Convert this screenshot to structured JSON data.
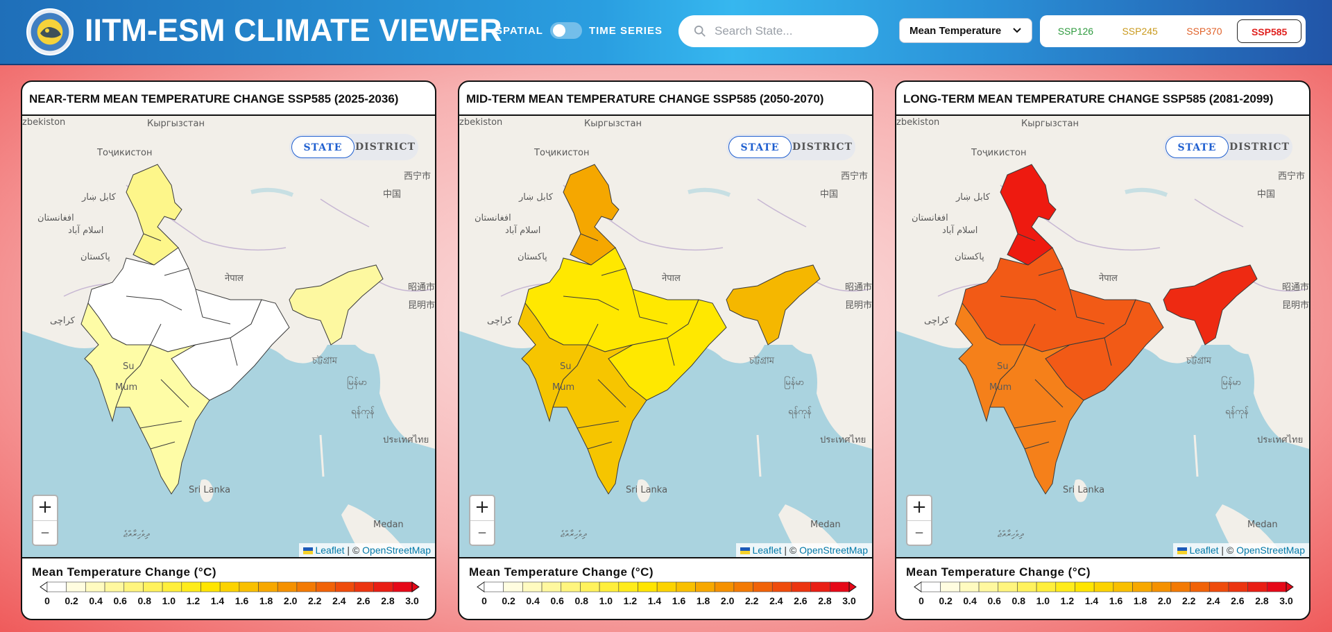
{
  "header": {
    "title": "IITM-ESM CLIMATE VIEWER",
    "toggle_left": "SPATIAL",
    "toggle_right": "TIME SERIES",
    "search_placeholder": "Search State...",
    "variable": "Mean Temperature",
    "scenarios": [
      {
        "label": "SSP126",
        "color": "#2e9a3e",
        "active": false
      },
      {
        "label": "SSP245",
        "color": "#c9991c",
        "active": false
      },
      {
        "label": "SSP370",
        "color": "#e0622a",
        "active": false
      },
      {
        "label": "SSP585",
        "color": "#e0201e",
        "active": true
      }
    ]
  },
  "panels": [
    {
      "title": "NEAR-TERM MEAN TEMPERATURE CHANGE SSP585 (2025-2036)",
      "fill_north": "#fdf68a",
      "fill_central": "#ffffff",
      "fill_south": "#fefca6",
      "fill_ne": "#fdf8a0"
    },
    {
      "title": "MID-TERM MEAN TEMPERATURE CHANGE SSP585 (2050-2070)",
      "fill_north": "#f5a700",
      "fill_central": "#ffe800",
      "fill_south": "#f6c500",
      "fill_ne": "#f5b700"
    },
    {
      "title": "LONG-TERM MEAN TEMPERATURE CHANGE SSP585 (2081-2099)",
      "fill_north": "#ee1a10",
      "fill_central": "#f25a16",
      "fill_south": "#f5801a",
      "fill_ne": "#ee2a12"
    }
  ],
  "map": {
    "mode_state": "STATE",
    "mode_district": "DISTRICT",
    "zoom_in": "+",
    "zoom_out": "–",
    "attribution_leaflet": "Leaflet",
    "attribution_sep": " | © ",
    "attribution_osm": "OpenStreetMap",
    "labels": [
      "zbekiston",
      "Кыргызстан",
      "Тоҷикистон",
      "西宁市",
      "中国",
      "کابل ښار",
      "افغانستان",
      "اسلام آباد",
      "پاکستان",
      "नेपाल",
      "昭通市",
      "昆明市",
      "کراچی",
      "চট্টগ্রাম",
      "Su",
      "Mum",
      "မြန်မာ",
      "ရန်ကုန်",
      "ประเทศไทย",
      "Sri Lanka",
      "Medan",
      "ދިވެހިރާއްޖެ"
    ]
  },
  "legend": {
    "title": "Mean Temperature Change (°C)",
    "ticks": [
      "0",
      "0.2",
      "0.4",
      "0.6",
      "0.8",
      "1.0",
      "1.2",
      "1.4",
      "1.6",
      "1.8",
      "2.0",
      "2.2",
      "2.4",
      "2.6",
      "2.8",
      "3.0"
    ],
    "colors": [
      "#ffffff",
      "#fffde0",
      "#fffbc0",
      "#fff89f",
      "#fff57e",
      "#fff25d",
      "#ffef3c",
      "#ffec1b",
      "#ffe500",
      "#fcd300",
      "#f9c000",
      "#f7a800",
      "#f59100",
      "#f37a04",
      "#f16308",
      "#ef4c0c",
      "#ec3510",
      "#e91e14",
      "#e60818"
    ]
  }
}
